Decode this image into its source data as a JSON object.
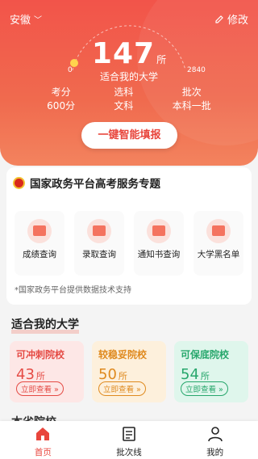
{
  "header": {
    "province": "安徽",
    "edit_label": "修改",
    "count": "147",
    "count_unit": "所",
    "count_caption": "适合我的大学",
    "range_min": "0",
    "range_max": "2840",
    "stats": [
      {
        "label": "考分",
        "value": "600分"
      },
      {
        "label": "选科",
        "value": "文科"
      },
      {
        "label": "批次",
        "value": "本科一批"
      }
    ],
    "cta_label": "一键智能填报"
  },
  "gov": {
    "title": "国家政务平台高考服务专题",
    "services": [
      "成绩查询",
      "录取查询",
      "通知书查询",
      "大学黑名单"
    ],
    "note": "*国家政务平台提供数据技术支持"
  },
  "suitable": {
    "title": "适合我的大学",
    "tiers": [
      {
        "name": "可冲刺院校",
        "count": "43",
        "unit": "所",
        "button": "立即查看 »"
      },
      {
        "name": "较稳妥院校",
        "count": "50",
        "unit": "所",
        "button": "立即查看 »"
      },
      {
        "name": "可保底院校",
        "count": "54",
        "unit": "所",
        "button": "立即查看 »"
      }
    ]
  },
  "local_title": "本省院校",
  "nav": [
    {
      "label": "首页",
      "icon": "home-icon",
      "active": true
    },
    {
      "label": "批次线",
      "icon": "document-icon",
      "active": false
    },
    {
      "label": "我的",
      "icon": "person-icon",
      "active": false
    }
  ],
  "colors": {
    "accent": "#e8453c",
    "tier_rush": "#e54b45",
    "tier_stable": "#df8a1f",
    "tier_safe": "#27a76c"
  }
}
